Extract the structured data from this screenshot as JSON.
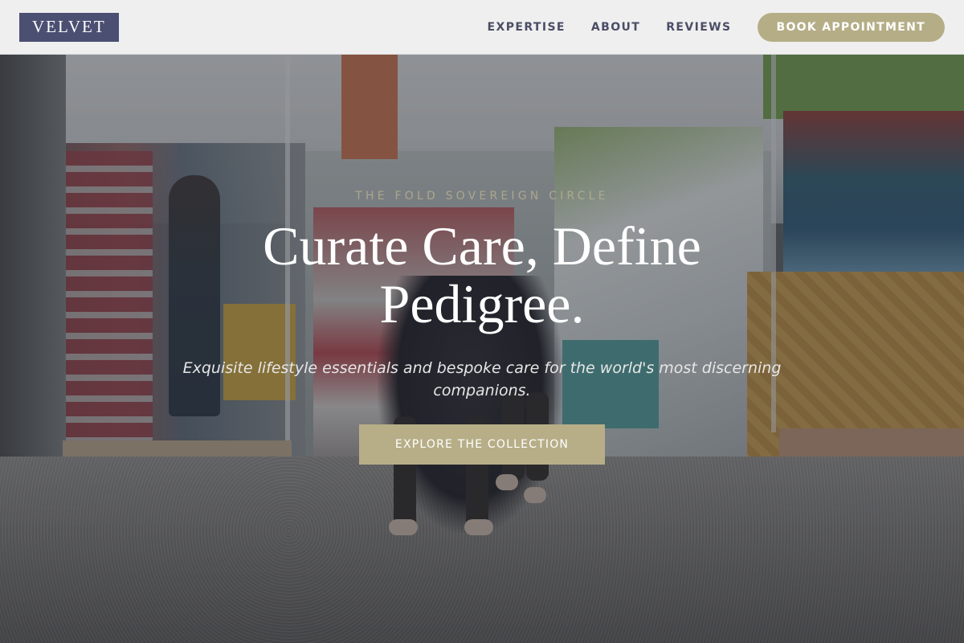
{
  "header": {
    "logo": "VELVET",
    "nav": [
      {
        "label": "EXPERTISE"
      },
      {
        "label": "ABOUT"
      },
      {
        "label": "REVIEWS"
      }
    ],
    "cta_label": "BOOK APPOINTMENT"
  },
  "hero": {
    "eyebrow": "THE FOLD SOVEREIGN CIRCLE",
    "headline": "Curate Care, Define Pedigree.",
    "subhead": "Exquisite lifestyle essentials and bespoke care for the world's most discerning companions.",
    "button_label": "EXPLORE THE COLLECTION"
  },
  "colors": {
    "logo_bg": "#4b4f72",
    "accent_gold": "#b5ad86",
    "nav_text": "#4a4d66"
  }
}
